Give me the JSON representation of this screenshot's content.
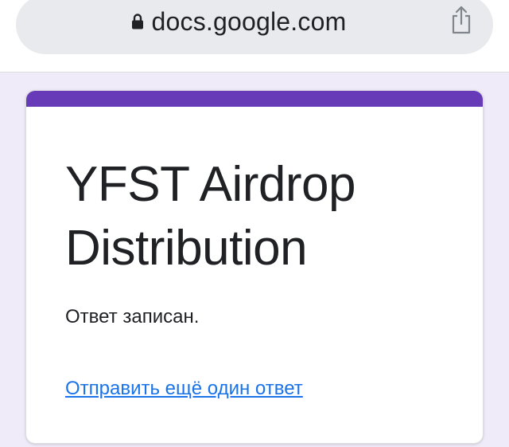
{
  "browser": {
    "url": "docs.google.com",
    "icons": {
      "lock": "lock-icon",
      "share": "share-icon"
    }
  },
  "form": {
    "title": "YFST Airdrop Distribution",
    "confirmation": "Ответ записан.",
    "submit_another_link": "Отправить ещё один ответ"
  },
  "colors": {
    "accent": "#673ab7",
    "page_background": "#f0ebf8",
    "link": "#1a73e8",
    "text": "#202124",
    "url_bar": "#e8eaed"
  }
}
